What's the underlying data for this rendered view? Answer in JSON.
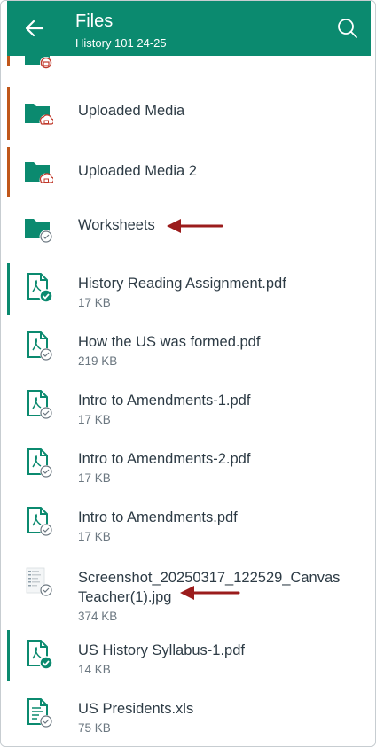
{
  "header": {
    "title": "Files",
    "subtitle": "History 101 24-25",
    "back_icon": "arrow-left-icon",
    "search_icon": "search-icon",
    "brand_color": "#0b8a6f"
  },
  "items": [
    {
      "name": "",
      "size": "",
      "type": "folder-locked",
      "stripe": "#c0571a"
    },
    {
      "name": "Uploaded Media",
      "size": "",
      "type": "folder-locked",
      "stripe": "#c0571a"
    },
    {
      "name": "Uploaded Media 2",
      "size": "",
      "type": "folder-locked",
      "stripe": "#c0571a"
    },
    {
      "name": "Worksheets",
      "size": "",
      "type": "folder-unpublished",
      "stripe": ""
    },
    {
      "name": "History Reading Assignment.pdf",
      "size": "17 KB",
      "type": "pdf-published",
      "stripe": "#0b8a6f"
    },
    {
      "name": "How the US was formed.pdf",
      "size": "219 KB",
      "type": "pdf-unpublished",
      "stripe": ""
    },
    {
      "name": "Intro to Amendments-1.pdf",
      "size": "17 KB",
      "type": "pdf-unpublished",
      "stripe": ""
    },
    {
      "name": "Intro to Amendments-2.pdf",
      "size": "17 KB",
      "type": "pdf-unpublished",
      "stripe": ""
    },
    {
      "name": "Intro to Amendments.pdf",
      "size": "17 KB",
      "type": "pdf-unpublished",
      "stripe": ""
    },
    {
      "name_line1": "Screenshot_20250317_122529_Canvas",
      "name_line2": "Teacher(1).jpg",
      "size": "374 KB",
      "type": "image-unpublished",
      "stripe": ""
    },
    {
      "name": "US History Syllabus-1.pdf",
      "size": "14 KB",
      "type": "pdf-published",
      "stripe": "#0b8a6f"
    },
    {
      "name": "US Presidents.xls",
      "size": "75 KB",
      "type": "document-unpublished",
      "stripe": ""
    }
  ],
  "annotation_color": "#9b1c1c"
}
